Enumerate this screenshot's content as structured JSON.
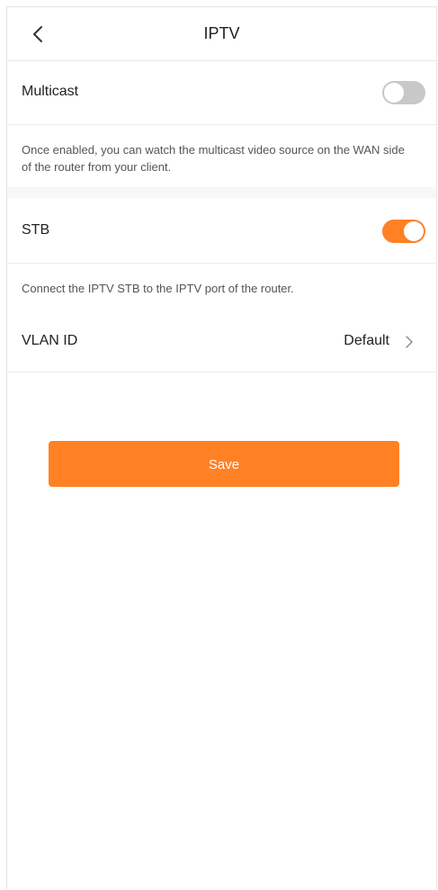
{
  "header": {
    "title": "IPTV",
    "back_icon": "chevron-left-icon"
  },
  "multicast": {
    "label": "Multicast",
    "enabled": false,
    "description": "Once enabled, you can watch the multicast video source on the WAN side of the router from your client."
  },
  "stb": {
    "label": "STB",
    "enabled": true,
    "description": "Connect the IPTV STB to the IPTV port of the router."
  },
  "vlan": {
    "label": "VLAN ID",
    "value": "Default",
    "chevron_icon": "chevron-right-icon"
  },
  "save": {
    "label": "Save"
  },
  "colors": {
    "accent": "#ff8124",
    "toggle_off": "#c8c8c8",
    "background": "#ffffff",
    "section_gap": "#f7f7f7"
  }
}
